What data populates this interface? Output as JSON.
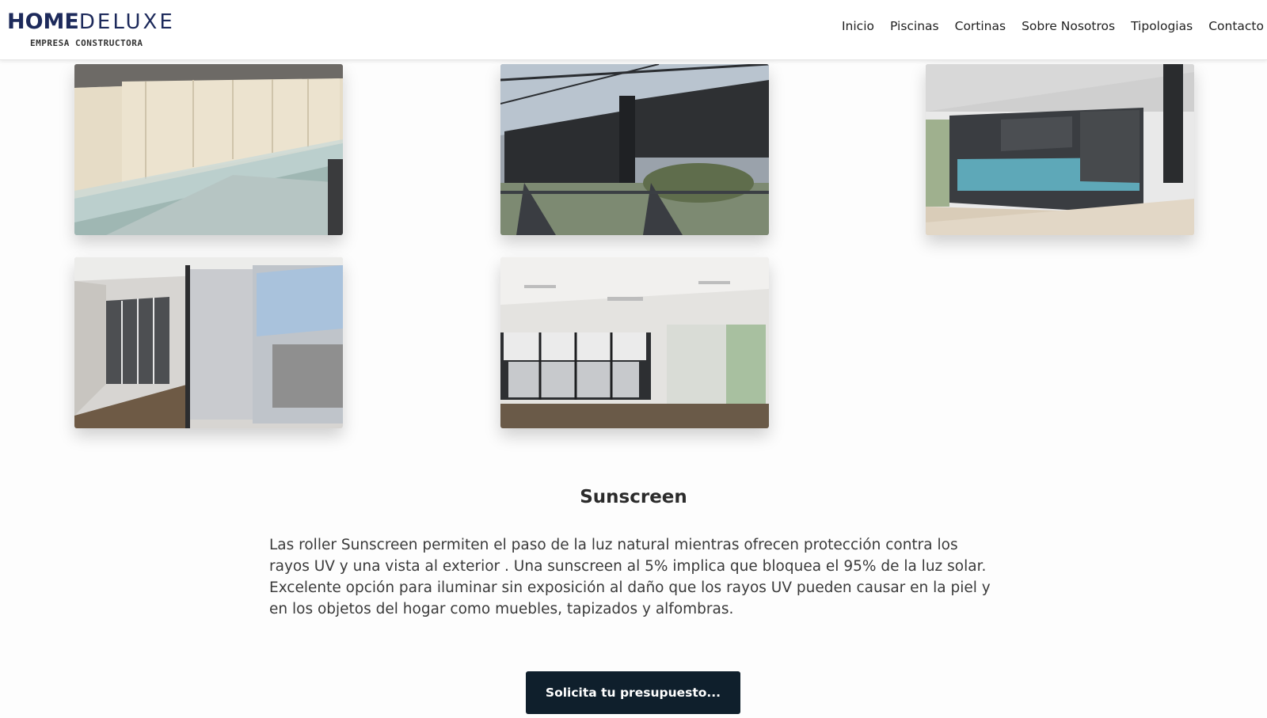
{
  "brand": {
    "name_bold": "HOME",
    "name_light": "DELUXE",
    "tagline": "EMPRESA CONSTRUCTORA",
    "color": "#1d2a5b"
  },
  "nav": {
    "items": [
      "Inicio",
      "Piscinas",
      "Cortinas",
      "Sobre Nosotros",
      "Tipologias",
      "Contacto"
    ]
  },
  "gallery": {
    "photos": [
      {
        "subject": "beige roller blinds over glass balcony"
      },
      {
        "subject": "dark sunscreen blinds on terrace pergola"
      },
      {
        "subject": "dark roller blinds facing pool"
      },
      {
        "subject": "white screen blinds in empty room"
      },
      {
        "subject": "white roller blinds on sliding windows"
      }
    ]
  },
  "section": {
    "title": "Sunscreen",
    "description": "Las roller Sunscreen permiten el paso de la luz natural mientras ofrecen protección contra los rayos UV y una vista al exterior . Una sunscreen al 5% implica que bloquea el 95% de la luz solar. Excelente opción para iluminar sin exposición al daño que los rayos UV pueden causar en la piel y en los objetos del hogar como muebles, tapizados y alfombras."
  },
  "cta": {
    "label": "Solicita tu presupuesto...",
    "color": "#0f1f2c"
  }
}
